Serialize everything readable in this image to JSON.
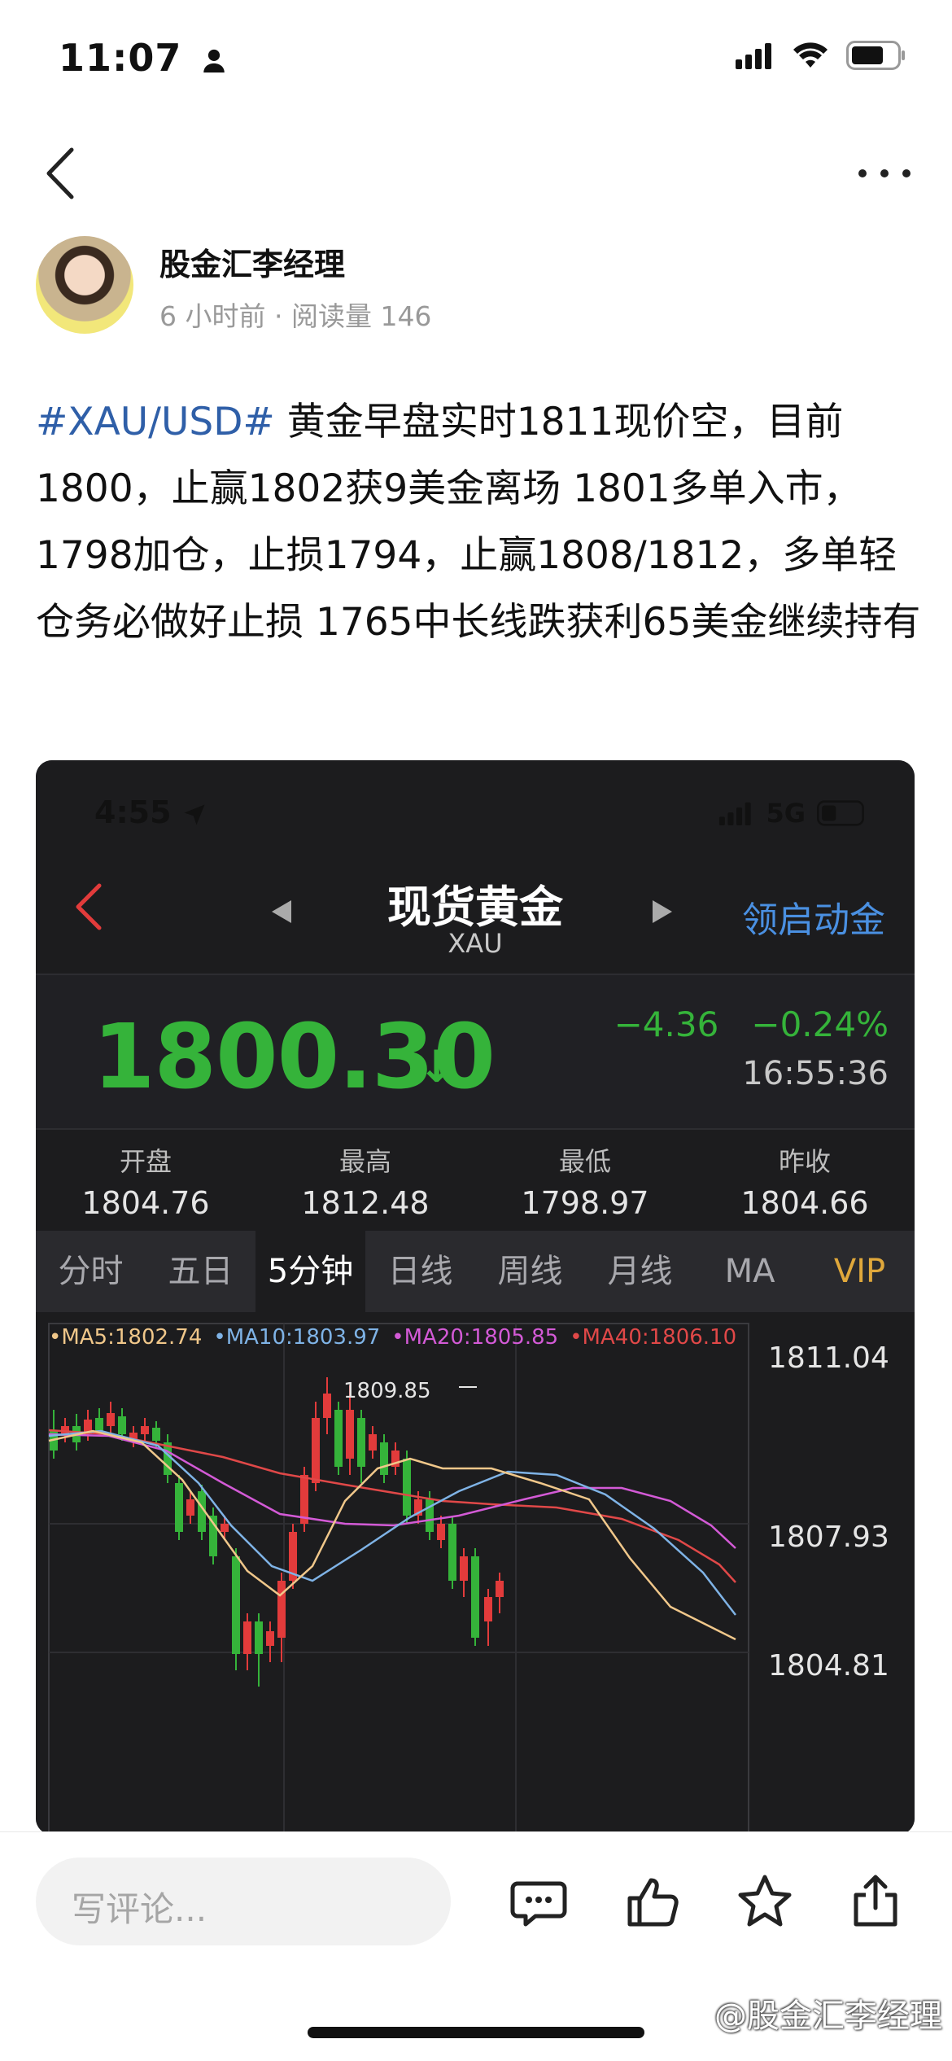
{
  "status_bar": {
    "time": "11:07"
  },
  "author": {
    "name": "股金汇李经理",
    "meta": "6 小时前 · 阅读量 146"
  },
  "post": {
    "hashtag": "#XAU/USD#",
    "text": " 黄金早盘实时1811现价空，目前1800，止赢1802获9美金离场 1801多单入市，1798加仓，止损1794，止赢1808/1812，多单轻仓务必做好止损 1765中长线跌获利65美金继续持有"
  },
  "screenshot": {
    "status_time": "4:55",
    "network": "5G",
    "title": "现货黄金",
    "subtitle": "XAU",
    "right_link": "领启动金",
    "price": "1800.30",
    "change": "−4.36",
    "change_pct": "−0.24%",
    "time": "16:55:36",
    "stats": [
      {
        "label": "开盘",
        "value": "1804.76"
      },
      {
        "label": "最高",
        "value": "1812.48"
      },
      {
        "label": "最低",
        "value": "1798.97"
      },
      {
        "label": "昨收",
        "value": "1804.66"
      }
    ],
    "tabs": [
      "分时",
      "五日",
      "5分钟",
      "日线",
      "周线",
      "月线",
      "MA",
      "VIP"
    ],
    "ma_legend": [
      {
        "text": "•MA5:1802.74",
        "color": "#f0c78a"
      },
      {
        "text": "•MA10:1803.97",
        "color": "#7fb3e6"
      },
      {
        "text": "•MA20:1805.85",
        "color": "#d35ad6"
      },
      {
        "text": "•MA40:1806.10",
        "color": "#e04848"
      }
    ],
    "y_ticks": [
      "1811.04",
      "1807.93",
      "1804.81"
    ],
    "high_marker": "1809.85"
  },
  "bottom": {
    "comment_placeholder": "写评论..."
  },
  "watermark": "@股金汇李经理",
  "colors": {
    "up": "#e23b3b",
    "down": "#35b33a",
    "link": "#2f5fa8",
    "vip": "#e0a83b"
  }
}
